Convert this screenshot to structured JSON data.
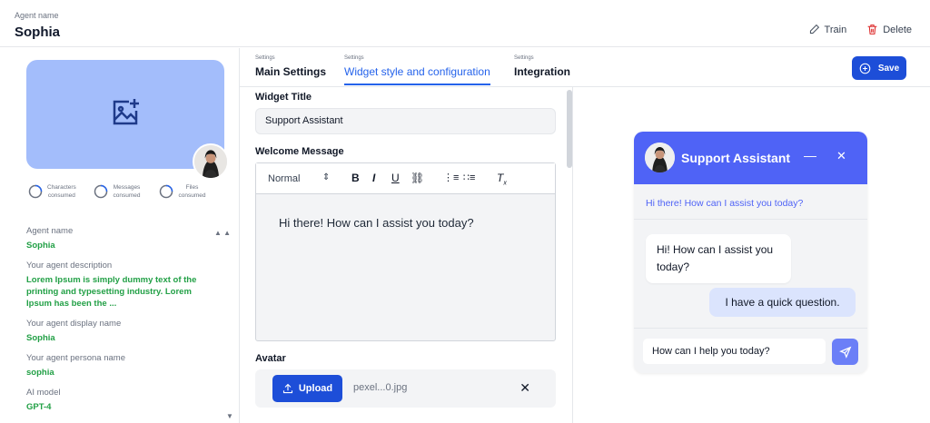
{
  "header": {
    "agent_label": "Agent name",
    "agent_name": "Sophia",
    "train_label": "Train",
    "delete_label": "Delete"
  },
  "stats": [
    {
      "label": "Characters consumed",
      "icon": "progress-ring-icon"
    },
    {
      "label": "Messages consumed",
      "icon": "progress-ring-icon"
    },
    {
      "label": "Files consumed",
      "icon": "progress-ring-icon"
    }
  ],
  "agent_info": [
    {
      "key": "Agent name",
      "value": "Sophia"
    },
    {
      "key": "Your agent description",
      "value": "Lorem Ipsum is simply dummy text of the printing and typesetting industry. Lorem Ipsum has been the ..."
    },
    {
      "key": "Your agent display name",
      "value": "Sophia"
    },
    {
      "key": "Your agent persona name",
      "value": "sophia"
    },
    {
      "key": "AI model",
      "value": "GPT-4"
    }
  ],
  "tabs": [
    {
      "sub": "Settings",
      "title": "Main Settings",
      "active": false
    },
    {
      "sub": "Settings",
      "title": "Widget style and configuration",
      "active": true
    },
    {
      "sub": "Settings",
      "title": "Integration",
      "active": false
    }
  ],
  "save_label": "Save",
  "form": {
    "widget_title_label": "Widget Title",
    "widget_title_value": "Support Assistant",
    "welcome_label": "Welcome Message",
    "editor_format": "Normal",
    "editor_text": "Hi there! How can I assist you today?",
    "avatar_label": "Avatar",
    "upload_label": "Upload",
    "file_name": "pexel...0.jpg"
  },
  "widget": {
    "title": "Support Assistant",
    "greeting": "Hi there! How can I assist you today?",
    "bot_message": "Hi! How can I assist you today?",
    "user_message": "I have a quick question.",
    "input_placeholder": "How can I help you today?",
    "header_color": "#4f63f6"
  },
  "colors": {
    "accent": "#2563eb",
    "button": "#1d4ed8",
    "info_value": "#22a046",
    "cover": "#a3bdfb"
  }
}
